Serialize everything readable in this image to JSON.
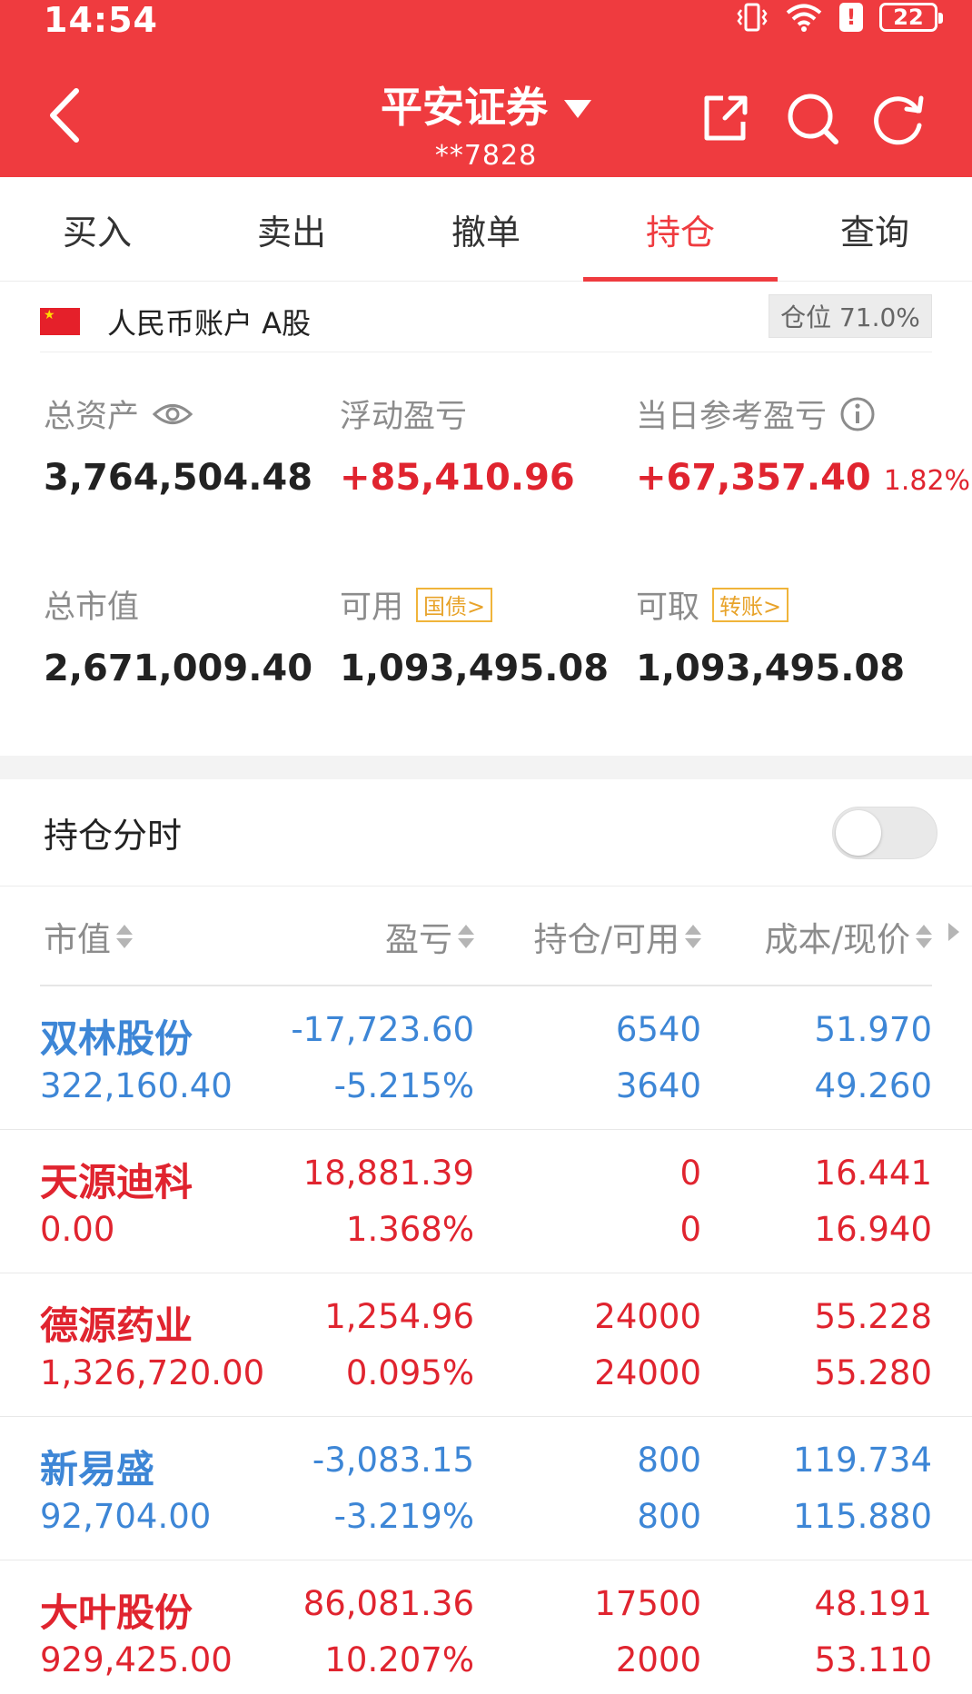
{
  "status_bar": {
    "time": "14:54",
    "battery": "22",
    "alert": "!"
  },
  "header": {
    "broker": "平安证券",
    "account_masked": "**7828",
    "icons": [
      "back-chevron-icon",
      "share-icon",
      "search-icon",
      "refresh-icon"
    ]
  },
  "tabs": [
    {
      "label": "买入",
      "active": false
    },
    {
      "label": "卖出",
      "active": false
    },
    {
      "label": "撤单",
      "active": false
    },
    {
      "label": "持仓",
      "active": true
    },
    {
      "label": "查询",
      "active": false
    }
  ],
  "account": {
    "name": "人民币账户 A股",
    "position_ratio": "仓位 71.0%"
  },
  "summary": {
    "total_assets": {
      "label": "总资产",
      "value": "3,764,504.48"
    },
    "floating_pnl": {
      "label": "浮动盈亏",
      "value": "+85,410.96"
    },
    "daily_pnl": {
      "label": "当日参考盈亏",
      "value": "+67,357.40",
      "percent": "1.82%"
    },
    "market_value": {
      "label": "总市值",
      "value": "2,671,009.40"
    },
    "available": {
      "label": "可用",
      "tag": "国债>",
      "value": "1,093,495.08"
    },
    "withdrawable": {
      "label": "可取",
      "tag": "转账>",
      "value": "1,093,495.08"
    }
  },
  "timeshare": {
    "label": "持仓分时",
    "enabled": false
  },
  "table": {
    "headers": [
      "市值",
      "盈亏",
      "持仓/可用",
      "成本/现价"
    ],
    "rows": [
      {
        "name": "双林股份",
        "market_value": "322,160.40",
        "pnl": "-17,723.60",
        "pnl_pct": "-5.215%",
        "holding": "6540",
        "available": "3640",
        "cost": "51.970",
        "price": "49.260",
        "color": "#3d86d6"
      },
      {
        "name": "天源迪科",
        "market_value": "0.00",
        "pnl": "18,881.39",
        "pnl_pct": "1.368%",
        "holding": "0",
        "available": "0",
        "cost": "16.441",
        "price": "16.940",
        "color": "#e0242f"
      },
      {
        "name": "德源药业",
        "market_value": "1,326,720.00",
        "pnl": "1,254.96",
        "pnl_pct": "0.095%",
        "holding": "24000",
        "available": "24000",
        "cost": "55.228",
        "price": "55.280",
        "color": "#e0242f"
      },
      {
        "name": "新易盛",
        "market_value": "92,704.00",
        "pnl": "-3,083.15",
        "pnl_pct": "-3.219%",
        "holding": "800",
        "available": "800",
        "cost": "119.734",
        "price": "115.880",
        "color": "#3d86d6"
      },
      {
        "name": "大叶股份",
        "market_value": "929,425.00",
        "pnl": "86,081.36",
        "pnl_pct": "10.207%",
        "holding": "17500",
        "available": "2000",
        "cost": "48.191",
        "price": "53.110",
        "color": "#e0242f"
      }
    ]
  },
  "colors": {
    "brand_red": "#ef3b3f",
    "up": "#e0242f",
    "down": "#3d86d6",
    "tag": "#e8a32a"
  }
}
